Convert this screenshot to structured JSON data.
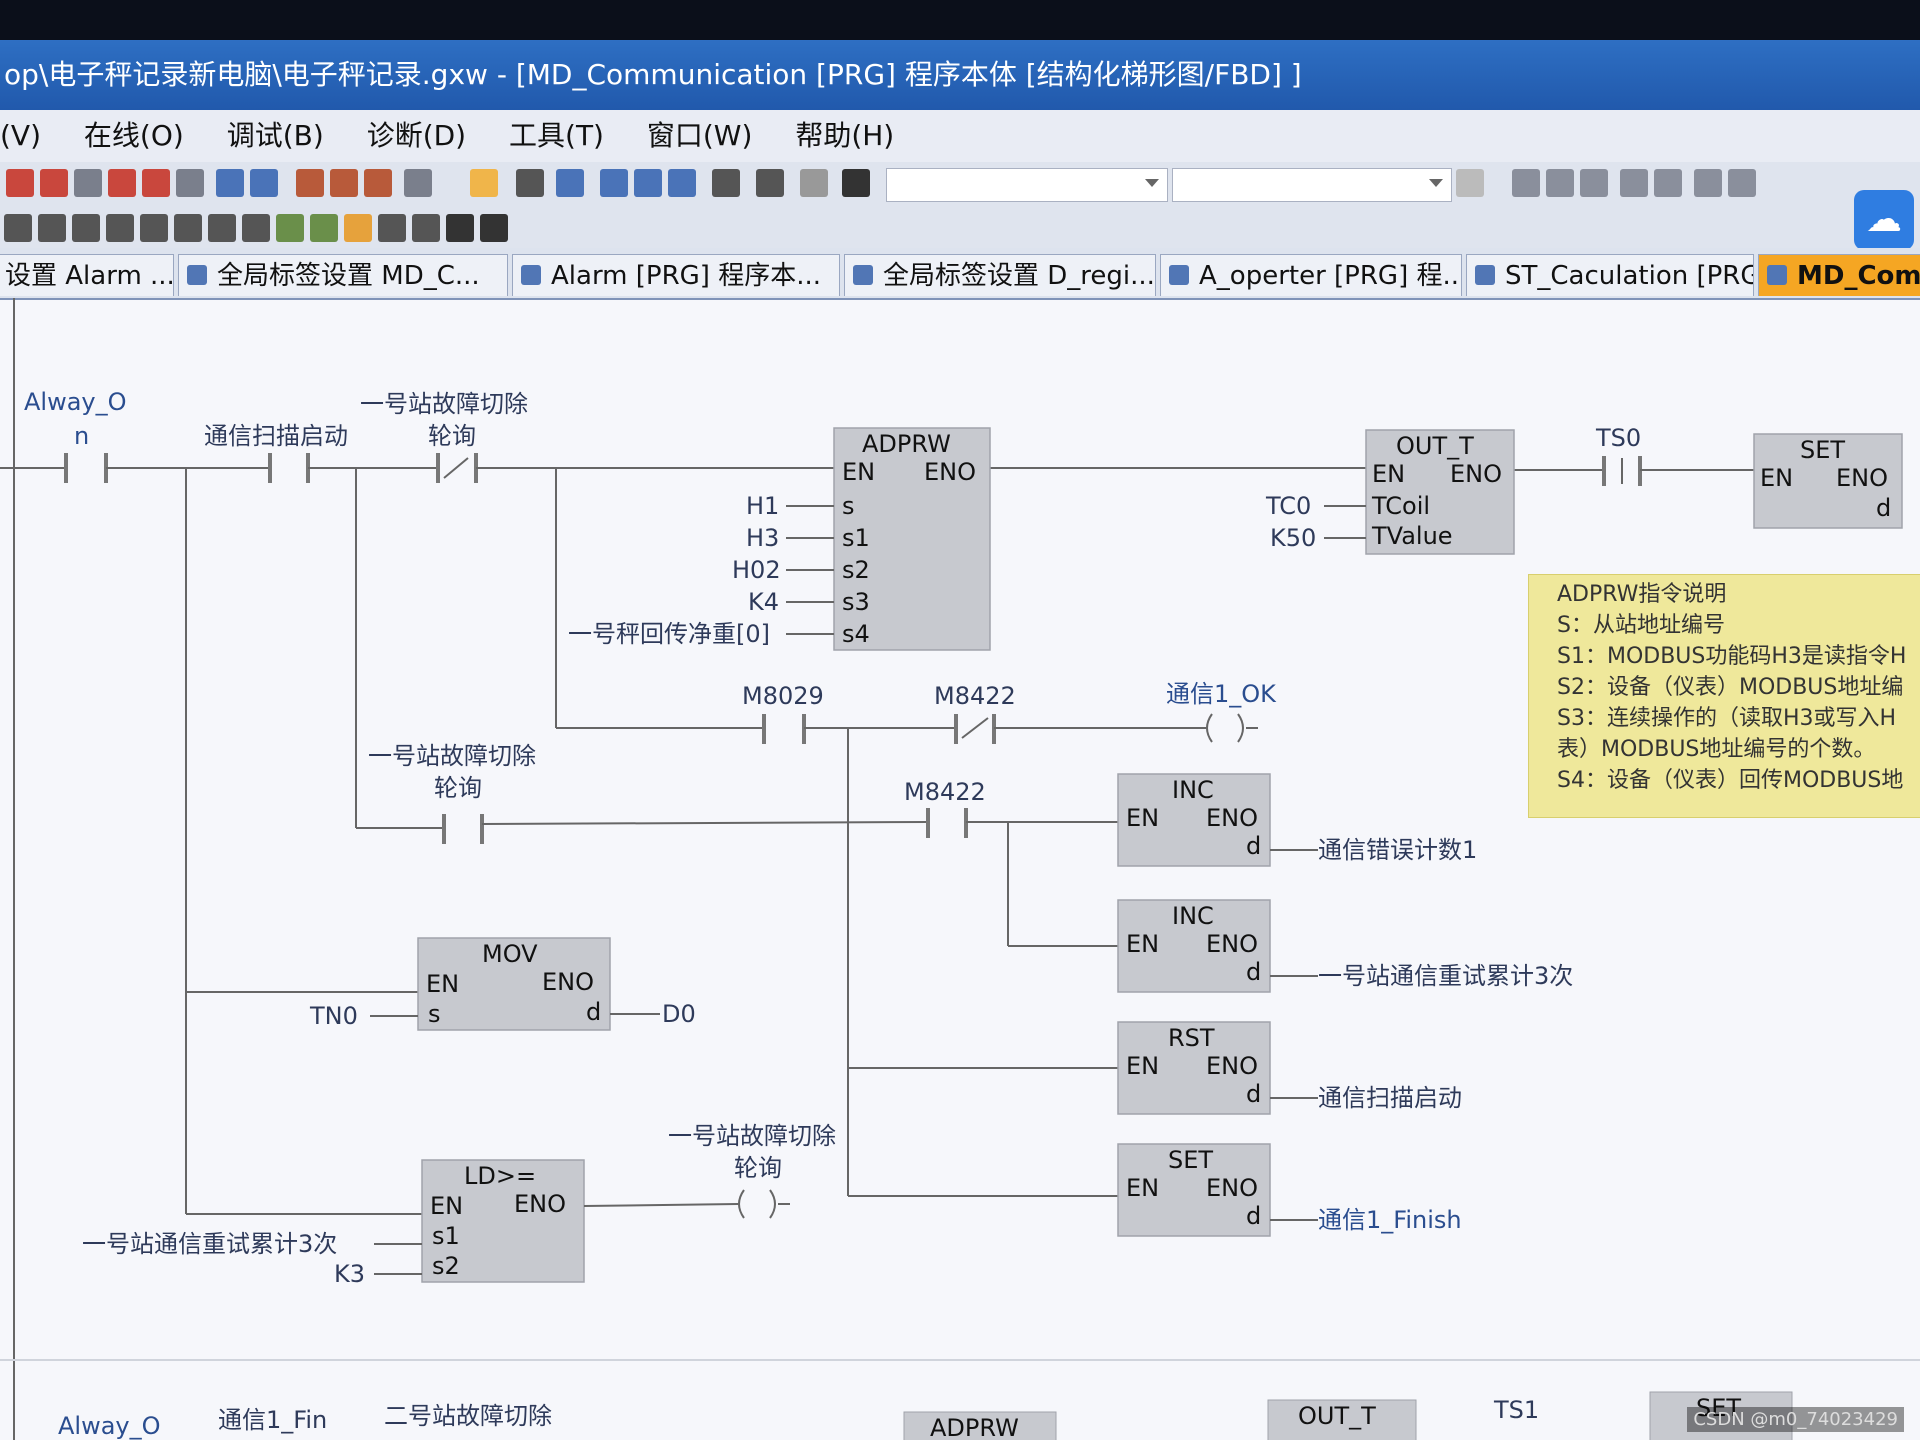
{
  "window": {
    "title": "op\\电子秤记录新电脑\\电子秤记录.gxw - [MD_Communication [PRG] 程序本体 [结构化梯形图/FBD] ]"
  },
  "menu": [
    "(V)",
    "在线(O)",
    "调试(B)",
    "诊断(D)",
    "工具(T)",
    "窗口(W)",
    "帮助(H)"
  ],
  "tabs": [
    {
      "label": "设置 Alarm ..."
    },
    {
      "label": "全局标签设置 MD_C..."
    },
    {
      "label": "Alarm [PRG] 程序本..."
    },
    {
      "label": "全局标签设置 D_regi..."
    },
    {
      "label": "A_operter [PRG] 程..."
    },
    {
      "label": "ST_Caculation [PRG]"
    },
    {
      "label": "MD_Comm"
    }
  ],
  "ladder": {
    "labels": {
      "alway": "Alway_O",
      "alway_n": "n",
      "scan_start": "通信扫描启动",
      "fault1_a": "一号站故障切除",
      "fault1_b": "轮询",
      "h1": "H1",
      "h3": "H3",
      "h02": "H02",
      "k4": "K4",
      "net_weight": "一号秤回传净重[0]",
      "m8029": "M8029",
      "m8422a": "M8422",
      "ok": "通信1_OK",
      "fault2_a": "一号站故障切除",
      "fault2_b": "轮询",
      "m8422b": "M8422",
      "err_count": "通信错误计数1",
      "retry": "一号站通信重试累计3次",
      "scan_start2": "通信扫描启动",
      "finish": "通信1_Finish",
      "tn0": "TN0",
      "d0": "D0",
      "fault3_a": "一号站故障切除",
      "fault3_b": "轮询",
      "retry2": "一号站通信重试累计3次",
      "k3": "K3",
      "tc0": "TC0",
      "k50": "K50",
      "ts0": "TS0"
    },
    "blocks": {
      "adprw": {
        "name": "ADPRW",
        "en": "EN",
        "eno": "ENO",
        "pins": [
          "s",
          "s1",
          "s2",
          "s3",
          "s4"
        ]
      },
      "out_t": {
        "name": "OUT_T",
        "en": "EN",
        "eno": "ENO",
        "pins": [
          "TCoil",
          "TValue"
        ]
      },
      "set_top": {
        "name": "SET",
        "en": "EN",
        "eno": "ENO",
        "d": "d"
      },
      "inc1": {
        "name": "INC",
        "en": "EN",
        "eno": "ENO",
        "d": "d"
      },
      "inc2": {
        "name": "INC",
        "en": "EN",
        "eno": "ENO",
        "d": "d"
      },
      "rst": {
        "name": "RST",
        "en": "EN",
        "eno": "ENO",
        "d": "d"
      },
      "set2": {
        "name": "SET",
        "en": "EN",
        "eno": "ENO",
        "d": "d"
      },
      "mov": {
        "name": "MOV",
        "en": "EN",
        "eno": "ENO",
        "s": "s",
        "d": "d"
      },
      "ld": {
        "name": "LD>=",
        "en": "EN",
        "eno": "ENO",
        "s1": "s1",
        "s2": "s2"
      }
    },
    "bottom": {
      "alway": "Alway_O",
      "fin": "通信1_Fin",
      "fault": "二号站故障切除",
      "adprw": "ADPRW",
      "out_t": "OUT_T",
      "ts1": "TS1",
      "set": "SET"
    }
  },
  "note": {
    "lines": [
      "ADPRW指令说明",
      "S：从站地址编号",
      "S1：MODBUS功能码H3是读指令H",
      "S2：设备（仪表）MODBUS地址编",
      "S3：连续操作的（读取H3或写入H",
      "表）MODBUS地址编号的个数。",
      "S4：设备（仪表）回传MODBUS地"
    ]
  },
  "watermark": "CSDN @m0_74023429",
  "colors": {
    "titlebar": "#2159ac",
    "active_tab": "#f5a623",
    "note_bg": "#efe89b",
    "block": "#c7c9cf"
  }
}
